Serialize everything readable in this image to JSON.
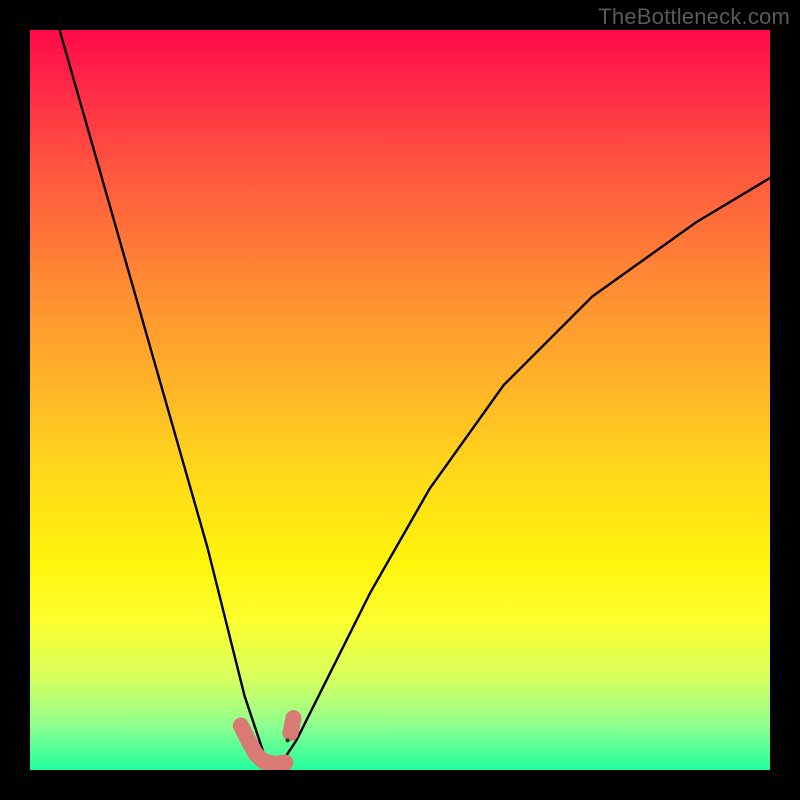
{
  "watermark": "TheBottleneck.com",
  "chart_data": {
    "type": "line",
    "title": "",
    "xlabel": "",
    "ylabel": "",
    "xlim": [
      0,
      100
    ],
    "ylim": [
      0,
      100
    ],
    "grid": false,
    "notes": "V-shaped curve on red→yellow→green vertical gradient; minimum near x≈32 at y≈0; salmon rounded markers cluster near the minimum.",
    "series": [
      {
        "name": "curve",
        "x": [
          4,
          8,
          12,
          16,
          20,
          24,
          27,
          29,
          31,
          32,
          33,
          34,
          36,
          40,
          46,
          54,
          64,
          76,
          90,
          100
        ],
        "y": [
          100,
          86,
          72,
          58,
          44,
          30,
          18,
          10,
          4,
          1,
          0.5,
          1,
          4,
          12,
          24,
          38,
          52,
          64,
          74,
          80
        ]
      }
    ],
    "markers": [
      {
        "x": 28.5,
        "y": 6,
        "r": 1.6
      },
      {
        "x": 29.5,
        "y": 4,
        "r": 1.6
      },
      {
        "x": 30.5,
        "y": 2.2,
        "r": 1.6
      },
      {
        "x": 31.5,
        "y": 1.2,
        "r": 1.6
      },
      {
        "x": 33.0,
        "y": 0.8,
        "r": 1.6
      },
      {
        "x": 34.5,
        "y": 1.0,
        "r": 1.6
      },
      {
        "x": 35.2,
        "y": 5.0,
        "r": 1.6
      },
      {
        "x": 35.6,
        "y": 7.0,
        "r": 1.6
      }
    ]
  }
}
